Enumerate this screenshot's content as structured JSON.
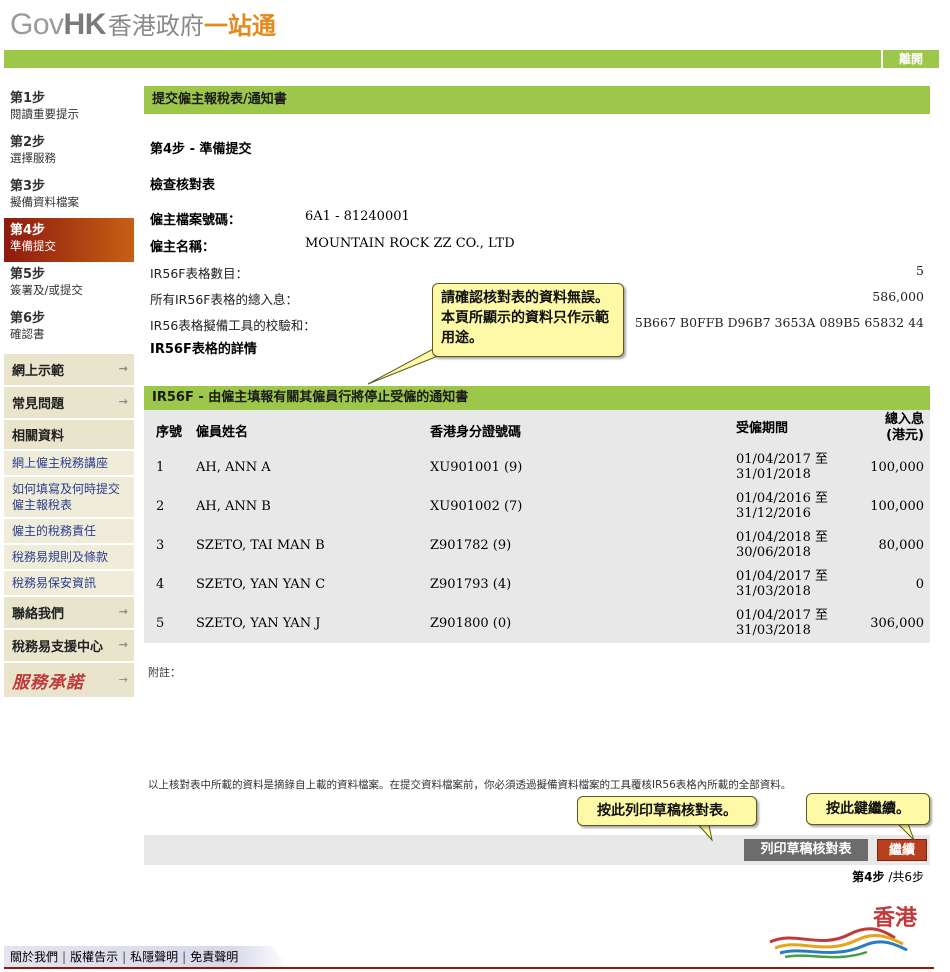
{
  "header": {
    "logo_gov": "Gov",
    "logo_hk": "HK",
    "logo_zh": "香港政府",
    "logo_zh2": "一站通",
    "logout": "離開"
  },
  "sidebar": {
    "steps": [
      {
        "title": "第1步",
        "desc": "閱讀重要提示",
        "active": false
      },
      {
        "title": "第2步",
        "desc": "選擇服務",
        "active": false
      },
      {
        "title": "第3步",
        "desc": "擬備資料檔案",
        "active": false
      },
      {
        "title": "第4步",
        "desc": "準備提交",
        "active": true
      },
      {
        "title": "第5步",
        "desc": "簽署及/或提交",
        "active": false
      },
      {
        "title": "第6步",
        "desc": "確認書",
        "active": false
      }
    ],
    "menu": {
      "demo": "網上示範",
      "faq": "常見問題",
      "related": "相關資料",
      "related_items": [
        "網上僱主稅務講座",
        "如何填寫及何時提交僱主報稅表",
        "僱主的稅務責任",
        "稅務易規則及條款",
        "稅務易保安資訊"
      ],
      "contact": "聯絡我們",
      "support": "稅務易支援中心",
      "pledge": "服務承諾"
    }
  },
  "main": {
    "title": "提交僱主報稅表/通知書",
    "step_heading": "第4步 - 準備提交",
    "check_heading": "檢查核對表",
    "file_no_label": "僱主檔案號碼：",
    "file_no": "6A1 - 81240001",
    "employer_label": "僱主名稱：",
    "employer": "MOUNTAIN ROCK ZZ CO., LTD",
    "count_label": "IR56F表格數目：",
    "count": "5",
    "total_label": "所有IR56F表格的總入息：",
    "total": "586,000",
    "checksum_label": "IR56表格擬備工具的校驗和：",
    "checksum": "5B667 B0FFB D96B7 3653A 089B5 65832 44",
    "details_heading": "IR56F表格的詳情",
    "form_title": "IR56F - 由僱主填報有關其僱員行將停止受僱的通知書",
    "table": {
      "headers": {
        "no": "序號",
        "name": "僱員姓名",
        "id": "香港身分證號碼",
        "period": "受僱期間",
        "total_1": "總入息",
        "total_2": "(港元)"
      },
      "rows": [
        {
          "no": "1",
          "name": "AH, ANN A",
          "id": "XU901001 (9)",
          "from": "01/04/2017 至",
          "to": "31/01/2018",
          "total": "100,000"
        },
        {
          "no": "2",
          "name": "AH, ANN B",
          "id": "XU901002 (7)",
          "from": "01/04/2016 至",
          "to": "31/12/2016",
          "total": "100,000"
        },
        {
          "no": "3",
          "name": "SZETO, TAI MAN B",
          "id": "Z901782 (9)",
          "from": "01/04/2018 至",
          "to": "30/06/2018",
          "total": "80,000"
        },
        {
          "no": "4",
          "name": "SZETO, YAN YAN C",
          "id": "Z901793 (4)",
          "from": "01/04/2017 至",
          "to": "31/03/2018",
          "total": "0"
        },
        {
          "no": "5",
          "name": "SZETO, YAN YAN J",
          "id": "Z901800 (0)",
          "from": "01/04/2017 至",
          "to": "31/03/2018",
          "total": "306,000"
        }
      ]
    },
    "remark_label": "附註：",
    "footnote": "以上核對表中所載的資料是摘錄自上載的資料檔案。在提交資料檔案前，你必須透過擬備資料檔案的工具覆核IR56表格內所載的全部資料。",
    "print_button": "列印草稿核對表",
    "continue_button": "繼續",
    "pager_step": "第4步",
    "pager_total": "/共6步"
  },
  "callouts": {
    "verify": "請確認核對表的資料無誤。本頁所顯示的資料只作示範用途。",
    "print": "按此列印草稿核對表。",
    "continue": "按此鍵繼續。"
  },
  "footer": {
    "links": [
      "關於我們",
      "版權告示",
      "私隱聲明",
      "免責聲明"
    ],
    "brand": "香港"
  },
  "colors": {
    "green": "#9cc74b",
    "active_step": "#a8300f",
    "continue_button": "#b9401e",
    "print_button": "#6c6c6c",
    "callout": "#fdf9a6"
  }
}
